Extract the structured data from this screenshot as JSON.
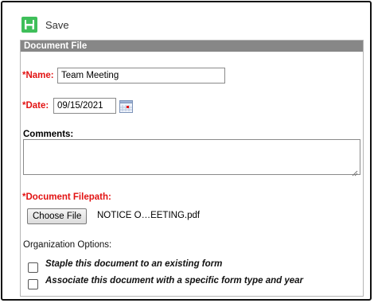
{
  "toolbar": {
    "save_label": "Save",
    "save_icon": "save-icon"
  },
  "panel": {
    "title": "Document File"
  },
  "form": {
    "name": {
      "asterisk": "*",
      "label": "Name:",
      "value": "Team Meeting"
    },
    "date": {
      "asterisk": "*",
      "label": "Date:",
      "value": "09/15/2021",
      "icon": "calendar-icon"
    },
    "comments": {
      "label": "Comments:",
      "value": ""
    },
    "filepath": {
      "asterisk": "*",
      "label": "Document Filepath:",
      "button_label": "Choose File",
      "file_name": "NOTICE O…EETING.pdf"
    },
    "org_options": {
      "label": "Organization Options:",
      "items": [
        {
          "label": "Staple this document to an existing form",
          "checked": false
        },
        {
          "label": "Associate this document with a specific form type and year",
          "checked": false
        }
      ]
    }
  },
  "colors": {
    "required": "#e21212",
    "header_bg": "#878787",
    "save_green": "#3fbf5a"
  }
}
